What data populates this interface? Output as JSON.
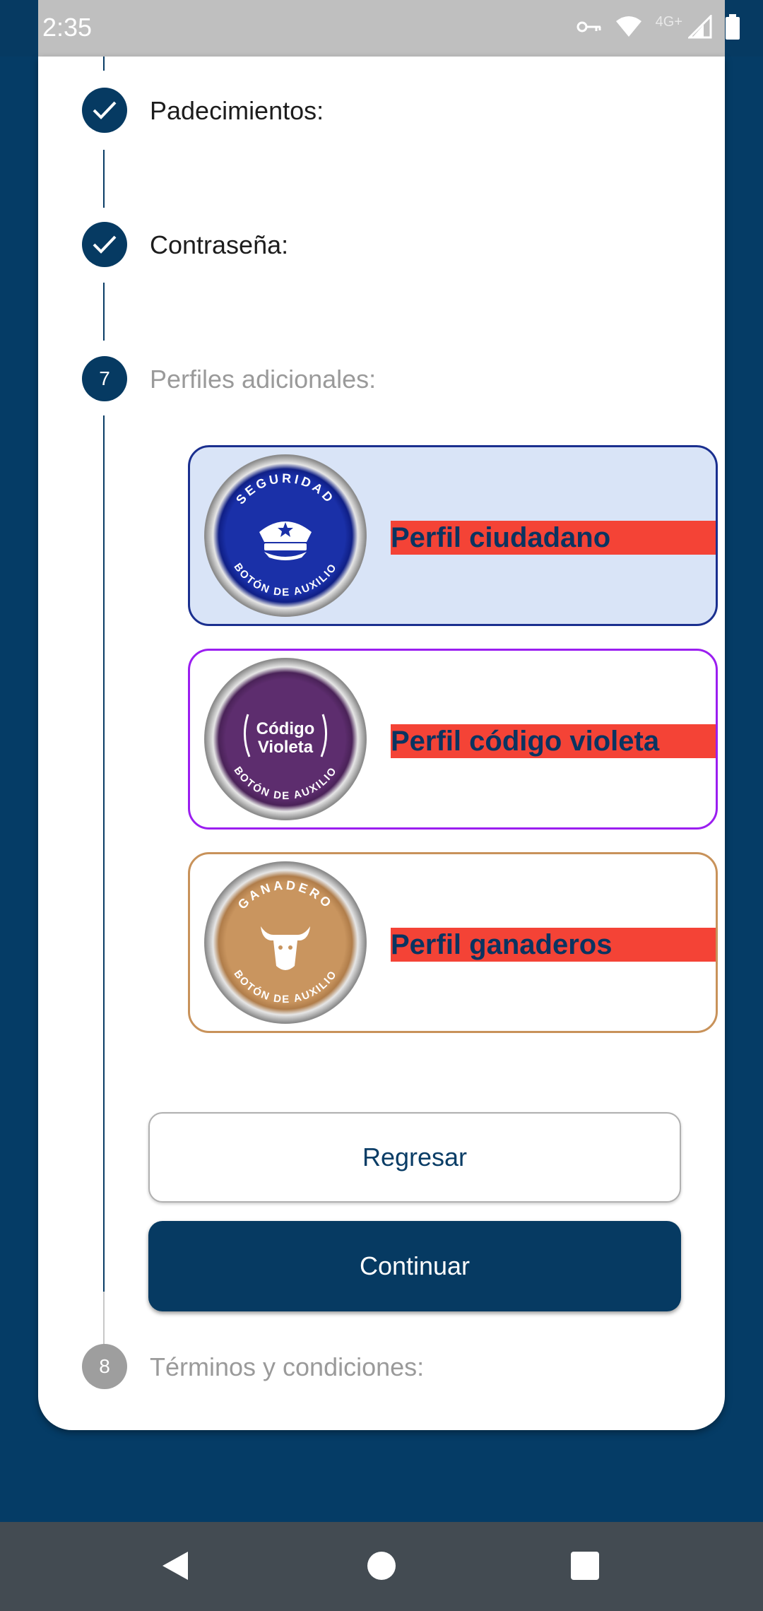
{
  "status": {
    "time": "2:35",
    "network": "4G+"
  },
  "steps": [
    {
      "label": "Padecimientos:",
      "state": "done"
    },
    {
      "label": "Contraseña:",
      "state": "done"
    },
    {
      "number": "7",
      "label": "Perfiles adicionales:",
      "state": "active"
    },
    {
      "number": "8",
      "label": "Términos y condiciones:",
      "state": "pending"
    }
  ],
  "profiles": [
    {
      "label": "Perfil ciudadano",
      "badge": {
        "top_text": "SEGURIDAD",
        "bottom_text": "BOTÓN DE AUXILIO",
        "icon": "police-cap-icon"
      },
      "colors": {
        "border": "#1a2f8f",
        "bg": "#d9e4f7",
        "badge": "#1a30a8"
      }
    },
    {
      "label": "Perfil código violeta",
      "badge": {
        "center_line1": "Código",
        "center_line2": "Violeta",
        "bottom_text": "BOTÓN DE AUXILIO",
        "icon": "laurel-icon"
      },
      "colors": {
        "border": "#9b1ef0",
        "bg": "#ffffff",
        "badge": "#5d2d6e"
      }
    },
    {
      "label": "Perfil ganaderos",
      "badge": {
        "top_text": "GANADERO",
        "bottom_text": "BOTÓN DE AUXILIO",
        "icon": "cow-icon"
      },
      "colors": {
        "border": "#c8925a",
        "bg": "#ffffff",
        "badge": "#c9955f"
      }
    }
  ],
  "buttons": {
    "back": "Regresar",
    "next": "Continuar"
  },
  "theme": {
    "primary": "#063a62",
    "highlight": "#f44336"
  }
}
